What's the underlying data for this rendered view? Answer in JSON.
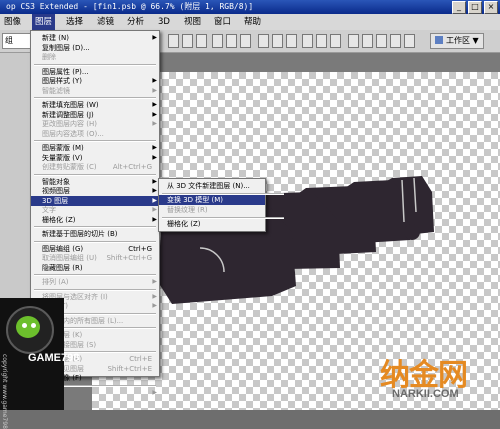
{
  "window": {
    "title": "op CS3 Extended - [fin1.psb @ 66.7% (附层 1, RGB/8)]",
    "buttons": [
      "_",
      "□",
      "×"
    ]
  },
  "menubar": {
    "items": [
      {
        "label": "图像"
      },
      {
        "label": "图层"
      },
      {
        "label": "选择"
      },
      {
        "label": "滤镜"
      },
      {
        "label": "分析"
      },
      {
        "label": "3D"
      },
      {
        "label": "视图"
      },
      {
        "label": "窗口"
      },
      {
        "label": "帮助"
      }
    ]
  },
  "options": {
    "field_value": "组",
    "workspace_label": "工作区 ▼"
  },
  "layer_menu": [
    {
      "label": "新建 (N)",
      "arrow": true
    },
    {
      "label": "复制图层 (D)..."
    },
    {
      "label": "删除",
      "disabled": true
    },
    {
      "sep": true
    },
    {
      "label": "图层属性 (P)..."
    },
    {
      "label": "图层样式 (Y)",
      "arrow": true
    },
    {
      "label": "智能滤镜",
      "disabled": true,
      "arrow": true
    },
    {
      "sep": true
    },
    {
      "label": "新建填充图层 (W)",
      "arrow": true
    },
    {
      "label": "新建调整图层 (J)",
      "arrow": true
    },
    {
      "label": "更改图层内容 (H)",
      "disabled": true,
      "arrow": true
    },
    {
      "label": "图层内容选项 (O)...",
      "disabled": true
    },
    {
      "sep": true
    },
    {
      "label": "图层蒙版 (M)",
      "arrow": true
    },
    {
      "label": "矢量蒙版 (V)",
      "arrow": true
    },
    {
      "label": "创建剪贴蒙版 (C)",
      "disabled": true,
      "shortcut": "Alt+Ctrl+G"
    },
    {
      "sep": true
    },
    {
      "label": "智能对象",
      "arrow": true
    },
    {
      "label": "视频图层",
      "arrow": true
    },
    {
      "label": "3D 图层",
      "arrow": true,
      "highlight": true
    },
    {
      "label": "文字",
      "disabled": true,
      "arrow": true
    },
    {
      "label": "栅格化 (Z)",
      "arrow": true
    },
    {
      "sep": true
    },
    {
      "label": "新建基于图层的切片 (B)"
    },
    {
      "sep": true
    },
    {
      "label": "图层编组 (G)",
      "shortcut": "Ctrl+G"
    },
    {
      "label": "取消图层编组 (U)",
      "disabled": true,
      "shortcut": "Shift+Ctrl+G"
    },
    {
      "label": "隐藏图层 (R)"
    },
    {
      "sep": true
    },
    {
      "label": "排列 (A)",
      "disabled": true,
      "arrow": true
    },
    {
      "sep": true
    },
    {
      "label": "将图层与选区对齐 (I)",
      "disabled": true,
      "arrow": true
    },
    {
      "label": "分布 (T)",
      "disabled": true,
      "arrow": true
    },
    {
      "sep": true
    },
    {
      "label": "锁定组内的所有图层 (L)...",
      "disabled": true
    },
    {
      "sep": true
    },
    {
      "label": "链接图层 (K)",
      "disabled": true
    },
    {
      "label": "选择链接图层 (S)",
      "disabled": true
    },
    {
      "sep": true
    },
    {
      "label": "合并图层 (E)",
      "disabled": true,
      "shortcut": "Ctrl+E"
    },
    {
      "label": "合并可见图层",
      "disabled": true,
      "shortcut": "Shift+Ctrl+E"
    },
    {
      "label": "拼合图像 (F)"
    },
    {
      "sep": true
    },
    {
      "label": "修边",
      "disabled": true,
      "arrow": true
    }
  ],
  "submenu_3d": [
    {
      "label": "从 3D 文件新建图层 (N)..."
    },
    {
      "sep": true
    },
    {
      "label": "变换 3D 模型 (M)",
      "highlight": true
    },
    {
      "label": "替换纹理 (R)",
      "disabled": true
    },
    {
      "sep": true
    },
    {
      "label": "栅格化 (Z)"
    }
  ],
  "logo": {
    "name": "GAME798",
    "vertical": "copyright www.game798"
  },
  "watermark": {
    "main": "纳金网",
    "url": "NARKII.COM"
  },
  "colors": {
    "menu_highlight": "#2a3a8a",
    "title_bar": "#0a2a8a",
    "car_silhouette": "#2e2630",
    "watermark_orange": "#e58a22"
  }
}
